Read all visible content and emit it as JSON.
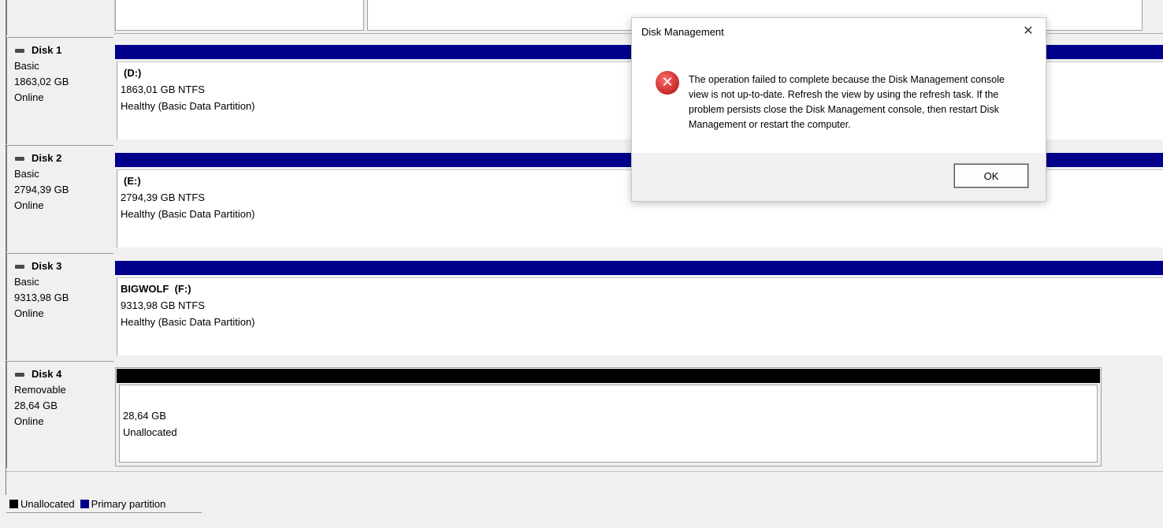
{
  "disks": [
    {
      "name": "Disk 1",
      "type": "Basic",
      "size": "1863,02 GB",
      "status": "Online",
      "volume": {
        "title": "(D:)",
        "fs": "1863,01 GB NTFS",
        "health": "Healthy (Basic Data Partition)"
      }
    },
    {
      "name": "Disk 2",
      "type": "Basic",
      "size": "2794,39 GB",
      "status": "Online",
      "volume": {
        "title": "(E:)",
        "fs": "2794,39 GB NTFS",
        "health": "Healthy (Basic Data Partition)"
      }
    },
    {
      "name": "Disk 3",
      "type": "Basic",
      "size": "9313,98 GB",
      "status": "Online",
      "volume": {
        "title": "BIGWOLF  (F:)",
        "fs": "9313,98 GB NTFS",
        "health": "Healthy (Basic Data Partition)"
      }
    },
    {
      "name": "Disk 4",
      "type": "Removable",
      "size": "28,64 GB",
      "status": "Online",
      "volume": {
        "title": "",
        "fs": "28,64 GB",
        "health": "Unallocated"
      }
    }
  ],
  "legend": [
    {
      "label": "Unallocated",
      "color": "#000000"
    },
    {
      "label": "Primary partition",
      "color": "#00008b"
    }
  ],
  "dialog": {
    "title": "Disk Management",
    "close": "✕",
    "icon": "error-icon",
    "message": "The operation failed to complete because the Disk Management console view is not up-to-date.  Refresh the view by using the refresh task. If the problem persists close the Disk Management console, then restart Disk Management or restart the computer.",
    "ok_label": "OK"
  }
}
